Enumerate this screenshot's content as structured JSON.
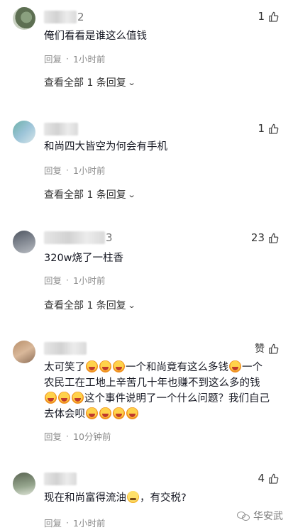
{
  "comments": [
    {
      "name_suffix": "2",
      "likes": "1",
      "text": "俺们看看是谁这么值钱",
      "reply_label": "回复",
      "time": "1小时前",
      "view_replies": "查看全部 1 条回复"
    },
    {
      "name_suffix": "",
      "likes": "1",
      "text": "和尚四大皆空为何会有手机",
      "reply_label": "回复",
      "time": "1小时前",
      "view_replies": "查看全部 1 条回复"
    },
    {
      "name_suffix": "3",
      "likes": "23",
      "text": "320w烧了一柱香",
      "reply_label": "回复",
      "time": "1小时前",
      "view_replies": "查看全部 1 条回复"
    },
    {
      "name_suffix": "",
      "like_label": "赞",
      "text_parts": [
        "太可笑了",
        "一个和尚竟有这么多钱",
        "一个农民工在工地上辛苦几十年也赚不到这么多的钱",
        "这个事件说明了一个什么问题？我们自己去体会呗",
        ""
      ],
      "reply_label": "回复",
      "time": "10分钟前"
    },
    {
      "name_suffix": "",
      "likes": "4",
      "text_parts": [
        "现在和尚富得流油",
        "，有交税?"
      ],
      "reply_label": "回复",
      "time": "1小时前"
    }
  ],
  "icons": {
    "like": "thumbs-up-icon",
    "chevron": "chevron-down-icon",
    "emoji": "laughing-emoji-icon"
  },
  "watermark": {
    "text": "华安武"
  }
}
